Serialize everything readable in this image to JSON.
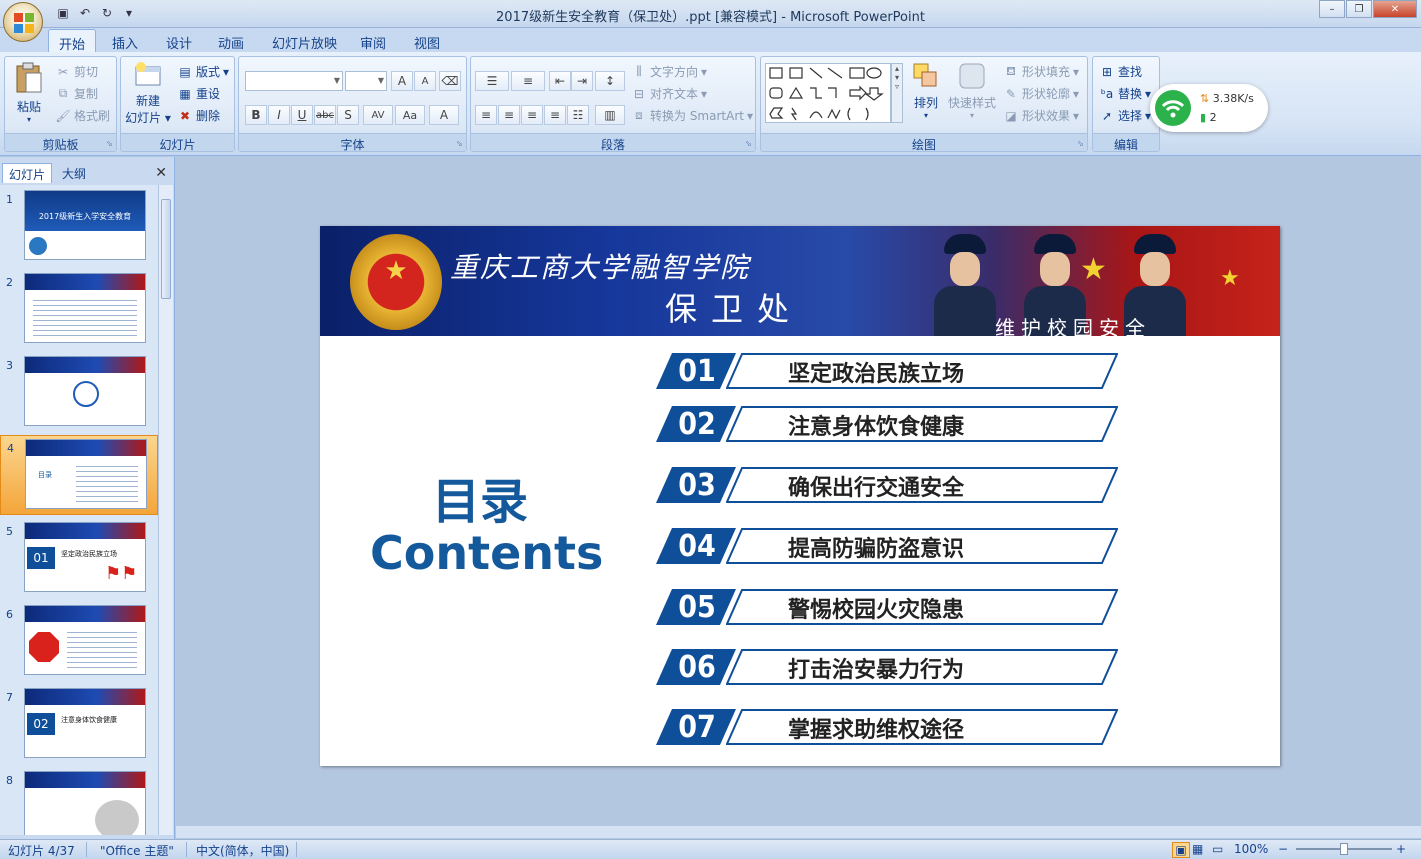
{
  "window": {
    "title": "2017级新生安全教育（保卫处）.ppt [兼容模式] - Microsoft PowerPoint",
    "office_button_icon": "office-logo-icon",
    "qat": [
      "save-icon",
      "undo-icon",
      "redo-icon",
      "customize-icon"
    ],
    "controls": {
      "minimize": "–",
      "restore": "❐",
      "close": "✕"
    }
  },
  "tabs": [
    {
      "label": "开始",
      "active": true
    },
    {
      "label": "插入"
    },
    {
      "label": "设计"
    },
    {
      "label": "动画"
    },
    {
      "label": "幻灯片放映"
    },
    {
      "label": "审阅"
    },
    {
      "label": "视图"
    }
  ],
  "ribbon": {
    "clipboard": {
      "label": "剪贴板",
      "paste": "粘贴",
      "cut": "剪切",
      "copy": "复制",
      "format_painter": "格式刷"
    },
    "slides": {
      "label": "幻灯片",
      "new_slide_1": "新建",
      "new_slide_2": "幻灯片",
      "layout": "版式",
      "reset": "重设",
      "delete": "删除"
    },
    "font": {
      "label": "字体",
      "bold": "B",
      "italic": "I",
      "underline": "U",
      "strike": "abc",
      "shadow": "S",
      "spacing": "AV",
      "case": "Aa",
      "color": "A",
      "grow": "A",
      "shrink": "A"
    },
    "paragraph": {
      "label": "段落",
      "text_direction": "文字方向",
      "align_text": "对齐文本",
      "smartart": "转换为 SmartArt"
    },
    "drawing": {
      "label": "绘图",
      "arrange": "排列",
      "quick_styles": "快速样式",
      "shape_fill": "形状填充",
      "shape_outline": "形状轮廓",
      "shape_effects": "形状效果"
    },
    "editing": {
      "label": "编辑",
      "find": "查找",
      "replace": "替换",
      "select": "选择"
    }
  },
  "net_widget": {
    "speed": "3.38K/s",
    "connections": "2",
    "accent": "#2cb24a"
  },
  "left_pane": {
    "tab_slides": "幻灯片",
    "tab_outline": "大纲",
    "close": "✕",
    "thumbnails": [
      {
        "num": "1",
        "title": "2017级新生入学安全教育"
      },
      {
        "num": "2"
      },
      {
        "num": "3"
      },
      {
        "num": "4",
        "selected": true,
        "text": "目录"
      },
      {
        "num": "5",
        "badge": "01",
        "text": "坚定政治民族立场"
      },
      {
        "num": "6"
      },
      {
        "num": "7",
        "badge": "02",
        "text": "注意身体饮食健康"
      },
      {
        "num": "8"
      }
    ]
  },
  "slide": {
    "school": "重庆工商大学融智学院",
    "dept": "保卫处",
    "motto": "维护校园安全",
    "toc_cn": "目录",
    "toc_en": "Contents",
    "items": [
      {
        "num": "01",
        "text": "坚定政治民族立场"
      },
      {
        "num": "02",
        "text": "注意身体饮食健康"
      },
      {
        "num": "03",
        "text": "确保出行交通安全"
      },
      {
        "num": "04",
        "text": "提高防骗防盗意识"
      },
      {
        "num": "05",
        "text": "警惕校园火灾隐患"
      },
      {
        "num": "06",
        "text": "打击治安暴力行为"
      },
      {
        "num": "07",
        "text": "掌握求助维权途径"
      }
    ],
    "colors": {
      "accent": "#0f4f9a",
      "title": "#14599b"
    }
  },
  "status": {
    "slide_pos": "幻灯片 4/37",
    "theme": "\"Office 主题\"",
    "language": "中文(简体，中国)",
    "zoom": "100%",
    "zoom_minus": "−",
    "zoom_plus": "+"
  }
}
